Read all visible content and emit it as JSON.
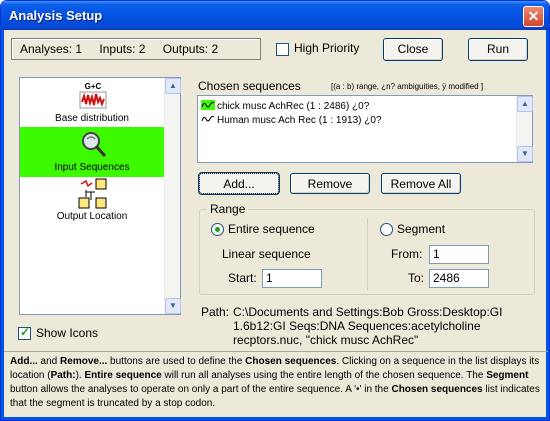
{
  "window": {
    "title": "Analysis Setup",
    "close_glyph": "✕"
  },
  "counts": {
    "analyses": "Analyses: 1",
    "inputs": "Inputs: 2",
    "outputs": "Outputs: 2"
  },
  "high_priority": {
    "label": "High Priority",
    "checked": false
  },
  "buttons": {
    "close": "Close",
    "run": "Run",
    "add": "Add...",
    "remove": "Remove",
    "remove_all": "Remove All"
  },
  "nav": {
    "items": [
      {
        "label": "Base distribution",
        "icon": "base-distribution-icon",
        "selected": false
      },
      {
        "label": "Input Sequences",
        "icon": "input-sequences-icon",
        "selected": true
      },
      {
        "label": "Output Location",
        "icon": "output-location-icon",
        "selected": false
      }
    ],
    "icon_text": "G+C"
  },
  "show_icons": {
    "label": "Show Icons",
    "checked": true
  },
  "chosen": {
    "title": "Chosen sequences",
    "legend": "[(a : b) range, ¿n? ambiguities, ÿ modified ]",
    "items": [
      {
        "label": "chick musc AchRec (1 : 2486) ¿0?",
        "highlighted": true
      },
      {
        "label": "Human musc Ach Rec (1 : 1913) ¿0?",
        "highlighted": false
      }
    ]
  },
  "range": {
    "title": "Range",
    "entire_label": "Entire sequence",
    "segment_label": "Segment",
    "selected": "entire",
    "linear_label": "Linear sequence",
    "start_label": "Start:",
    "start_value": "1",
    "from_label": "From:",
    "from_value": "1",
    "to_label": "To:",
    "to_value": "2486"
  },
  "path": {
    "label": "Path:",
    "line1": "C:\\Documents and Settings:Bob Gross:Desktop:GI",
    "line2": "1.6b12:GI Seqs:DNA Sequences:acetylcholine",
    "line3": "recptors.nuc, \"chick musc AchRec\""
  },
  "help": {
    "segments": [
      {
        "text": "Add...",
        "bold": true
      },
      {
        "text": " and ",
        "bold": false
      },
      {
        "text": "Remove...",
        "bold": true
      },
      {
        "text": " buttons are used to define the ",
        "bold": false
      },
      {
        "text": "Chosen sequences",
        "bold": true
      },
      {
        "text": ". Clicking on a sequence in the list displays its location (",
        "bold": false
      },
      {
        "text": "Path:",
        "bold": true
      },
      {
        "text": "). ",
        "bold": false
      },
      {
        "text": "Entire sequence",
        "bold": true
      },
      {
        "text": " will run all analyses using the entire length of the chosen sequence. The ",
        "bold": false
      },
      {
        "text": "Segment",
        "bold": true
      },
      {
        "text": " button allows the analyses to operate on only a part of the entire sequence. A '•' in the ",
        "bold": false
      },
      {
        "text": "Chosen sequences",
        "bold": true
      },
      {
        "text": " list indicates that the segment is truncated by a stop codon.",
        "bold": false
      }
    ]
  },
  "colors": {
    "selection": "#3dfa00",
    "titlebar": "#0553e2",
    "dialog": "#ece9d8"
  }
}
